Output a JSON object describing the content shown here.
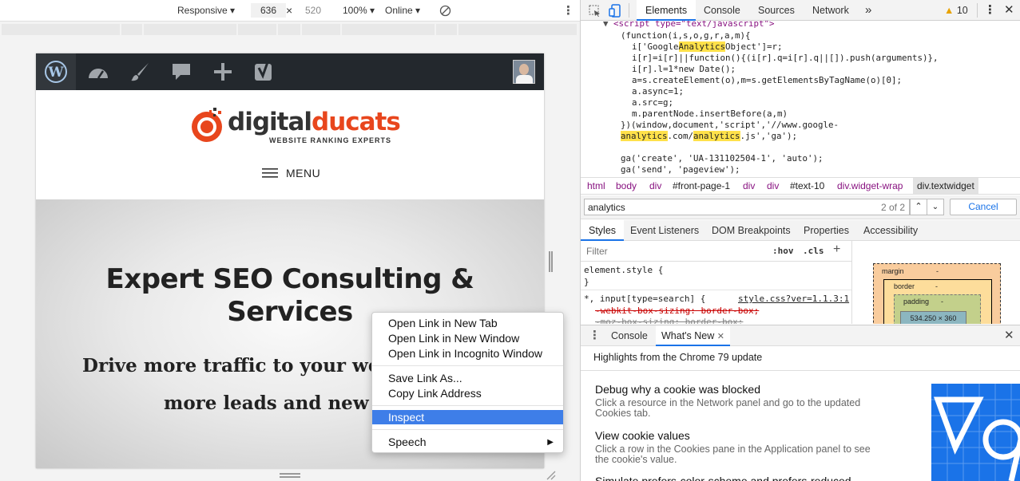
{
  "device_toolbar": {
    "mode": "Responsive",
    "width": "636",
    "times": "×",
    "height": "520",
    "zoom": "100%",
    "network": "Online"
  },
  "site": {
    "logo": {
      "part1": "digital",
      "part2": "ducats",
      "tagline": "WEBSITE RANKING EXPERTS"
    },
    "menu_label": "MENU",
    "hero_title_1": "Expert SEO Consulting &",
    "hero_title_2": "Services",
    "hero_sub_1": "Drive more traffic to your webs",
    "hero_sub_2": "more leads and new cli"
  },
  "context_menu": {
    "items": [
      {
        "label": "Open Link in New Tab"
      },
      {
        "label": "Open Link in New Window"
      },
      {
        "label": "Open Link in Incognito Window"
      },
      {
        "label": "Save Link As..."
      },
      {
        "label": "Copy Link Address"
      },
      {
        "label": "Inspect"
      },
      {
        "label": "Speech"
      }
    ]
  },
  "devtools": {
    "tabs": [
      "Elements",
      "Console",
      "Sources",
      "Network"
    ],
    "more": "»",
    "warning_count": "10",
    "code": {
      "l0_a": "<script type=\"text/javascript\">",
      "l1": "(function(i,s,o,g,r,a,m){",
      "l2_a": "i['Google",
      "l2_hl": "Analytics",
      "l2_b": "Object']=r;",
      "l3": "i[r]=i[r]||function(){(i[r].q=i[r].q||[]).push(arguments)},",
      "l4": "i[r].l=1*new Date();",
      "l5": "a=s.createElement(o),m=s.getElementsByTagName(o)[0];",
      "l6": "a.async=1;",
      "l7": "a.src=g;",
      "l8": "m.parentNode.insertBefore(a,m)",
      "l9": "})(window,document,'script','//www.google-",
      "l10_hl1": "analytics",
      "l10_mid": ".com/",
      "l10_hl2": "analytics",
      "l10_b": ".js','ga');",
      "l11": "ga('create', 'UA-131102504-1', 'auto');",
      "l12": "ga('send', 'pageview');"
    },
    "breadcrumbs": [
      "html",
      "body",
      "div",
      "#front-page-1",
      "div",
      "div",
      "#text-10",
      "div.widget-wrap",
      "div.textwidget"
    ],
    "search": {
      "value": "analytics",
      "count": "2 of 2",
      "cancel": "Cancel"
    },
    "subtabs": [
      "Styles",
      "Event Listeners",
      "DOM Breakpoints",
      "Properties",
      "Accessibility"
    ],
    "styles": {
      "filter_placeholder": "Filter",
      "hov": ":hov",
      "cls": ".cls",
      "plus": "+",
      "rule1": "element.style {",
      "rule1_close": "}",
      "rule2_sel": "*, input[type=search] {",
      "rule2_src": "style.css?ver=1.1.3:1",
      "rule2_p1": "-webkit-box-sizing: border-box;",
      "rule2_p2": "-moz-box-sizing: border-box;"
    },
    "boxmodel": {
      "margin": "margin",
      "border": "border",
      "padding": "padding",
      "content": "534.250 × 360",
      "dash": "-"
    },
    "drawer": {
      "tabs": [
        "Console",
        "What's New"
      ],
      "header": "Highlights from the Chrome 79 update",
      "items": [
        {
          "title": "Debug why a cookie was blocked",
          "desc1": "Click a resource in the Network panel and go to the updated",
          "desc2": "Cookies tab."
        },
        {
          "title": "View cookie values",
          "desc1": "Click a row in the Cookies pane in the Application panel to see",
          "desc2": "the cookie's value."
        },
        {
          "title": "Simulate prefers-color-scheme and prefers-reduced",
          "desc1": "",
          "desc2": ""
        }
      ]
    }
  },
  "colors": {
    "accent": "#1a73e8",
    "highlight": "#ffe14a",
    "menu_selected": "#3e7ee8",
    "logo_orange": "#e8461d",
    "admin_bar": "#23282d"
  }
}
